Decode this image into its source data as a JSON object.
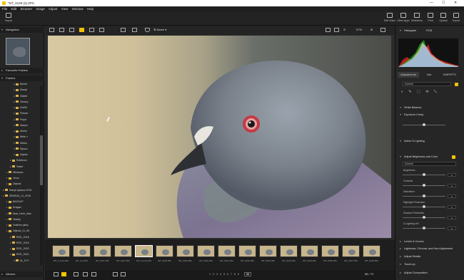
{
  "window": {
    "title": "*NT_0129 (2).JPG",
    "minimize": "—",
    "maximize": "☐",
    "close": "✕"
  },
  "menu": [
    "File",
    "Edit",
    "Browser",
    "Image",
    "Adjust",
    "View",
    "Window",
    "Help"
  ],
  "toolbar": {
    "import": "Import",
    "right_tools": [
      "Edit Video",
      "Other Apps",
      "Slideshow",
      "Print",
      "Upload",
      "Export"
    ]
  },
  "left_panel": {
    "navigation": "Navigation",
    "favourite_folders": "Favourite Folders",
    "folders_title": "Folders",
    "folders": [
      {
        "label": "Moreo",
        "indent": 3,
        "icon": "folder"
      },
      {
        "label": "Muzyk",
        "indent": 3,
        "icon": "music-folder"
      },
      {
        "label": "Obiekt",
        "indent": 3,
        "icon": "folder-3d"
      },
      {
        "label": "Obrazy",
        "indent": 3,
        "icon": "pictures-folder"
      },
      {
        "label": "OneDr",
        "indent": 3,
        "icon": "cloud-folder"
      },
      {
        "label": "Pobran",
        "indent": 3,
        "icon": "download-folder"
      },
      {
        "label": "Pulpit",
        "indent": 3,
        "icon": "desktop-folder"
      },
      {
        "label": "Ulepsz",
        "indent": 3,
        "icon": "folder"
      },
      {
        "label": "Ulubio",
        "indent": 3,
        "icon": "folder"
      },
      {
        "label": "Wide v",
        "indent": 3,
        "icon": "folder"
      },
      {
        "label": "Wideo",
        "indent": 3,
        "icon": "video-folder"
      },
      {
        "label": "Wyszu",
        "indent": 3,
        "icon": "search-folder"
      },
      {
        "label": "Zapisa",
        "indent": 3,
        "icon": "folder"
      },
      {
        "label": "Robbizzo",
        "indent": 2,
        "icon": "folder"
      },
      {
        "label": "Tester",
        "indent": 2,
        "icon": "folder"
      },
      {
        "label": "Windows",
        "indent": 1,
        "icon": "folder"
      },
      {
        "label": "Yerzo",
        "indent": 1,
        "icon": "folder"
      },
      {
        "label": "Zdjecia",
        "indent": 1,
        "icon": "folder"
      },
      {
        "label": "Stacja dyskow DVD",
        "indent": 0,
        "icon": "dvd-drive"
      },
      {
        "label": "ZENEDA_11_2016",
        "indent": 0,
        "icon": "drive"
      },
      {
        "label": "BACKUP",
        "indent": 1,
        "icon": "folder"
      },
      {
        "label": "Dragan",
        "indent": 1,
        "icon": "folder"
      },
      {
        "label": "Start_Here_Mac",
        "indent": 1,
        "icon": "folder"
      },
      {
        "label": "Tekstly",
        "indent": 1,
        "icon": "folder"
      },
      {
        "label": "Textfree plikio",
        "indent": 1,
        "icon": "folder"
      },
      {
        "label": "Zdjecia_11_09",
        "indent": 1,
        "icon": "folder"
      },
      {
        "label": "ROE_2018",
        "indent": 2,
        "icon": "folder"
      },
      {
        "label": "ROE_2019",
        "indent": 2,
        "icon": "folder"
      },
      {
        "label": "ROE_2020",
        "indent": 2,
        "icon": "folder"
      },
      {
        "label": "ROE_2021",
        "indent": 2,
        "icon": "folder"
      },
      {
        "label": "01_STY",
        "indent": 3,
        "icon": "folder"
      }
    ],
    "albums": "Albums"
  },
  "viewbar": {
    "sort": "Name",
    "zoom": "97%"
  },
  "filmstrip": {
    "thumbs": [
      "NIT_0_9 (2).JPG",
      "NIT_0_9.JPG",
      "NIT_0107.JPG",
      "NIT_0125.JPG",
      "NIT_0_9 (2).JPG",
      "NIT_0128.JPG",
      "NIT_0129.JPG",
      "NIT_0130.JPG",
      "NIT_0131.JPG",
      "NIT_0132.JPG",
      "NIT_0133.JPG",
      "NIT_0134.JPG",
      "NIT_0135.JPG",
      "NIT_0136.JPG",
      "NIT_0137.JPG",
      "NIT_0138.JPG"
    ],
    "selected_index": 4
  },
  "status": {
    "pages": [
      "1",
      "2",
      "3",
      "4",
      "5",
      "6",
      "7",
      "8",
      "9"
    ],
    "current_page": "58",
    "counter": "58 / 72"
  },
  "right_panel": {
    "histogram_title": "Histogram",
    "histogram_channel": "RGB",
    "tabs": [
      "Adjustments",
      "Info",
      "XMP/IPTC"
    ],
    "preset": "Current",
    "sections": {
      "white_balance": "White Balance",
      "exposure": "Exposure Comp.",
      "adl": "Active D-Lighting",
      "brightness_color": "Adjust Brightness and Color",
      "brightness_preset": "Current",
      "levels": "Levels & Curves",
      "lch": "Lightness, Chroma, and Hue Adjustment",
      "adjust_details": "Adjust Details",
      "touchup": "Touch-up",
      "composition": "Adjust Composition"
    },
    "sliders": [
      {
        "label": "Brightness",
        "value": "0"
      },
      {
        "label": "Contrast",
        "value": "0"
      },
      {
        "label": "Saturation",
        "value": "0"
      },
      {
        "label": "Highlight Protection",
        "value": "0"
      },
      {
        "label": "Shadow Protection",
        "value": "0"
      },
      {
        "label": "D-Lighting HS",
        "value": "0"
      }
    ]
  },
  "colors": {
    "accent": "#f2c200",
    "bg": "#2b2b2b"
  }
}
